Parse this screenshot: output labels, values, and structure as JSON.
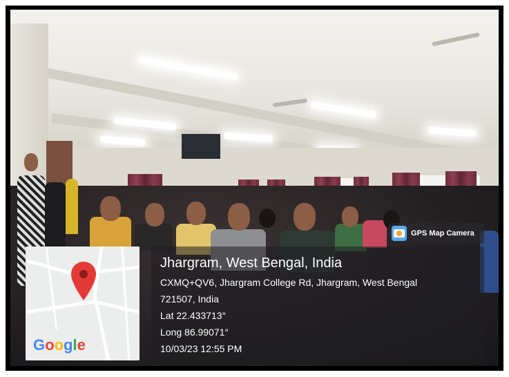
{
  "overlay": {
    "badge_label": "GPS Map Camera",
    "location_title": "Jhargram, West Bengal, India",
    "address_line1": "CXMQ+QV6, Jhargram College Rd, Jhargram, West Bengal",
    "address_line2": "721507, India",
    "latitude": "Lat 22.433713°",
    "longitude": "Long 86.99071°",
    "timestamp": "10/03/23 12:55 PM"
  },
  "map": {
    "logo_letters": [
      "G",
      "o",
      "o",
      "g",
      "l",
      "e"
    ],
    "pin_color": "#e53935",
    "icon": "map-pin-icon"
  },
  "colors": {
    "frame": "#000000",
    "curtain": "#7a3344",
    "info_box": "rgba(30,30,34,0.55)"
  }
}
